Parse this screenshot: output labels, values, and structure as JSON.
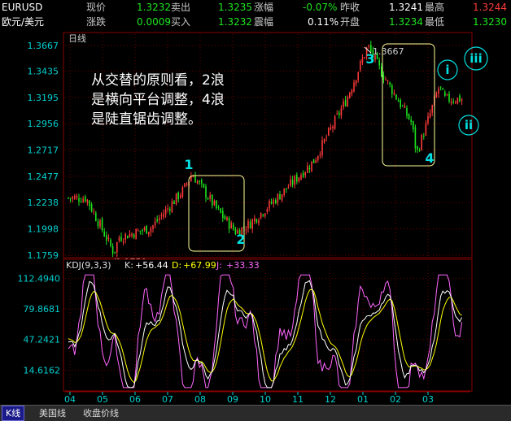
{
  "quote": {
    "symbol": "EURUSD",
    "name": "欧元/美元",
    "rows": [
      [
        {
          "label": "现价",
          "value": "1.3232",
          "color": "green"
        },
        {
          "label": "卖出",
          "value": "1.3235",
          "color": "green"
        },
        {
          "label": "涨幅",
          "value": "-0.07%",
          "color": "green"
        },
        {
          "label": "昨收",
          "value": "1.3241",
          "color": "white"
        },
        {
          "label": "最高",
          "value": "1.3244",
          "color": "red"
        }
      ],
      [
        {
          "label": "涨跌",
          "value": "0.0009",
          "color": "green"
        },
        {
          "label": "买入",
          "value": "1.3232",
          "color": "green"
        },
        {
          "label": "震幅",
          "value": "0.11%",
          "color": "white"
        },
        {
          "label": "开盘",
          "value": "1.3234",
          "color": "green"
        },
        {
          "label": "最低",
          "value": "1.3230",
          "color": "green"
        }
      ]
    ]
  },
  "chart_data": [
    {
      "type": "candlestick",
      "period_label": "日线",
      "y_ticks": [
        "1.3667",
        "1.3435",
        "1.3195",
        "1.2956",
        "1.2717",
        "1.2477",
        "1.2238",
        "1.1998",
        "1.1759"
      ],
      "ylim": [
        1.1759,
        1.3667
      ],
      "x_ticks": [
        "04",
        "05",
        "06",
        "07",
        "08",
        "09",
        "10",
        "11",
        "12",
        "01",
        "02",
        "03"
      ],
      "grid": true,
      "series": [
        {
          "name": "close",
          "x": [
            "04",
            "05",
            "06",
            "07",
            "08",
            "09",
            "10",
            "11",
            "12",
            "01",
            "02",
            "03"
          ],
          "values": [
            1.228,
            1.192,
            1.201,
            1.236,
            1.218,
            1.204,
            1.232,
            1.262,
            1.318,
            1.346,
            1.296,
            1.318
          ]
        }
      ],
      "extremes": [
        {
          "label": "1.1759",
          "x": "05",
          "y": 1.1759
        },
        {
          "label": "1.3667",
          "x": "01",
          "y": 1.3667
        }
      ],
      "annotation_text": [
        "从交替的原则看，2浪",
        "是横向平台调整，4浪",
        "是陡直锯齿调整。"
      ],
      "wave_labels": [
        {
          "label": "1",
          "x": "07",
          "y": 1.248,
          "color": "#00e0e0"
        },
        {
          "label": "2",
          "x": "09",
          "y": 1.196,
          "color": "#00e0e0"
        },
        {
          "label": "3",
          "x": "12",
          "y": 1.358,
          "color": "#00e0e0"
        },
        {
          "label": "4",
          "x": "01",
          "y": 1.264,
          "color": "#00e0e0"
        },
        {
          "label": "i",
          "x": "02",
          "y": 1.339,
          "color": "#00e0e0"
        },
        {
          "label": "ii",
          "x": "03",
          "y": 1.295,
          "color": "#00e0e0"
        },
        {
          "label": "iii",
          "x": "03",
          "y": 1.353,
          "color": "#00e0e0"
        }
      ]
    },
    {
      "type": "line",
      "indicator_label": "KDJ(9,3,3)",
      "readouts": [
        {
          "label": "K:",
          "value": "+56.44",
          "color": "#ffffff"
        },
        {
          "label": "D:",
          "value": "+67.99",
          "color": "#ffff00"
        },
        {
          "label": "J:",
          "value": "+33.33",
          "color": "#ff66ff"
        }
      ],
      "y_ticks": [
        "112.4940",
        "79.8681",
        "47.2421",
        "14.6162"
      ],
      "ylim": [
        -5,
        118
      ],
      "colors": {
        "K": "#ffffff",
        "D": "#ffff00",
        "J": "#ff66ff"
      }
    }
  ],
  "bottom_tabs": [
    {
      "label": "K线",
      "active": true
    },
    {
      "label": "美国线",
      "active": false
    },
    {
      "label": "收盘价线",
      "active": false
    }
  ],
  "colors": {
    "up": "#ff3a3a",
    "down": "#1ee61e",
    "axis": "#8a0000",
    "grid": "#6a0000",
    "box": "#ffff99",
    "tick": "#00d0d0"
  }
}
